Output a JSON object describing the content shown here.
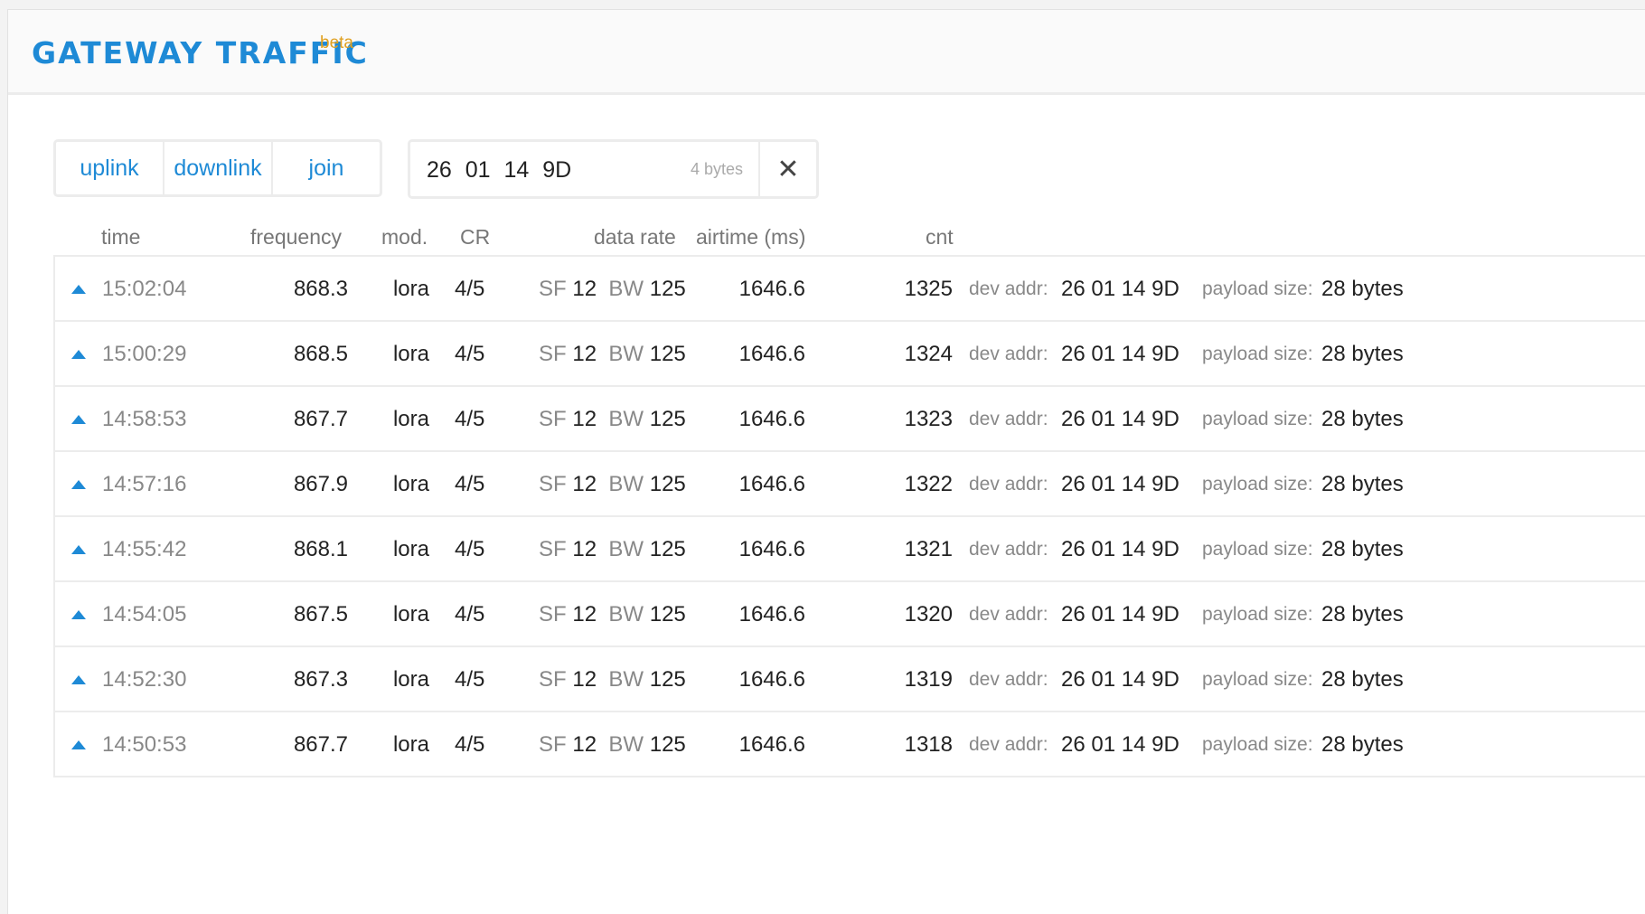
{
  "header": {
    "title": "GATEWAY TRAFFIC",
    "badge": "beta"
  },
  "filters": {
    "uplink": "uplink",
    "downlink": "downlink",
    "join": "join"
  },
  "search": {
    "value": "26 01 14 9D",
    "meta": "4 bytes",
    "clear_icon": "close-icon"
  },
  "columns": {
    "time": "time",
    "frequency": "frequency",
    "mod": "mod.",
    "cr": "CR",
    "data_rate": "data rate",
    "airtime": "airtime (ms)",
    "cnt": "cnt"
  },
  "labels": {
    "sf": "SF",
    "bw": "BW",
    "dev_addr": "dev addr:",
    "payload_size": "payload size:"
  },
  "rows": [
    {
      "time": "15:02:04",
      "frequency": "868.3",
      "mod": "lora",
      "cr": "4/5",
      "sf": "12",
      "bw": "125",
      "airtime": "1646.6",
      "cnt": "1325",
      "dev_addr": "26 01 14 9D",
      "payload": "28 bytes"
    },
    {
      "time": "15:00:29",
      "frequency": "868.5",
      "mod": "lora",
      "cr": "4/5",
      "sf": "12",
      "bw": "125",
      "airtime": "1646.6",
      "cnt": "1324",
      "dev_addr": "26 01 14 9D",
      "payload": "28 bytes"
    },
    {
      "time": "14:58:53",
      "frequency": "867.7",
      "mod": "lora",
      "cr": "4/5",
      "sf": "12",
      "bw": "125",
      "airtime": "1646.6",
      "cnt": "1323",
      "dev_addr": "26 01 14 9D",
      "payload": "28 bytes"
    },
    {
      "time": "14:57:16",
      "frequency": "867.9",
      "mod": "lora",
      "cr": "4/5",
      "sf": "12",
      "bw": "125",
      "airtime": "1646.6",
      "cnt": "1322",
      "dev_addr": "26 01 14 9D",
      "payload": "28 bytes"
    },
    {
      "time": "14:55:42",
      "frequency": "868.1",
      "mod": "lora",
      "cr": "4/5",
      "sf": "12",
      "bw": "125",
      "airtime": "1646.6",
      "cnt": "1321",
      "dev_addr": "26 01 14 9D",
      "payload": "28 bytes"
    },
    {
      "time": "14:54:05",
      "frequency": "867.5",
      "mod": "lora",
      "cr": "4/5",
      "sf": "12",
      "bw": "125",
      "airtime": "1646.6",
      "cnt": "1320",
      "dev_addr": "26 01 14 9D",
      "payload": "28 bytes"
    },
    {
      "time": "14:52:30",
      "frequency": "867.3",
      "mod": "lora",
      "cr": "4/5",
      "sf": "12",
      "bw": "125",
      "airtime": "1646.6",
      "cnt": "1319",
      "dev_addr": "26 01 14 9D",
      "payload": "28 bytes"
    },
    {
      "time": "14:50:53",
      "frequency": "867.7",
      "mod": "lora",
      "cr": "4/5",
      "sf": "12",
      "bw": "125",
      "airtime": "1646.6",
      "cnt": "1318",
      "dev_addr": "26 01 14 9D",
      "payload": "28 bytes"
    }
  ]
}
